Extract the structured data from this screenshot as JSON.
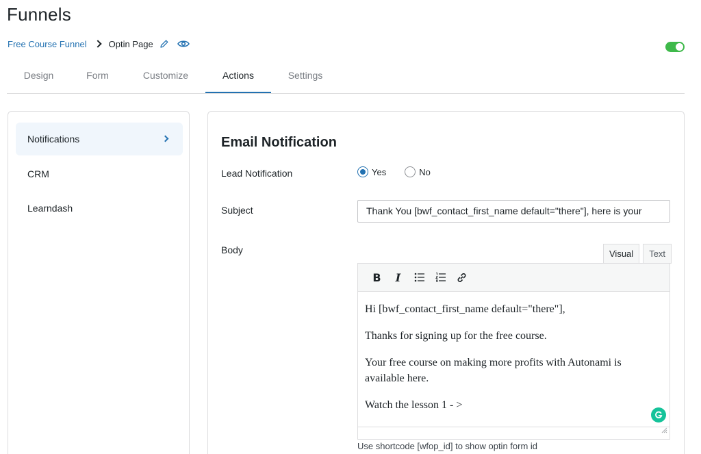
{
  "page": {
    "title": "Funnels"
  },
  "breadcrumb": {
    "parent": "Free Course Funnel",
    "current": "Optin Page"
  },
  "toggle": {
    "state": "on",
    "color": "#3eb94a"
  },
  "tabs": [
    {
      "label": "Design"
    },
    {
      "label": "Form"
    },
    {
      "label": "Customize"
    },
    {
      "label": "Actions",
      "active": true
    },
    {
      "label": "Settings"
    }
  ],
  "sidebar": {
    "items": [
      {
        "label": "Notifications",
        "active": true
      },
      {
        "label": "CRM"
      },
      {
        "label": "Learndash"
      }
    ]
  },
  "email": {
    "section_title": "Email Notification",
    "lead_label": "Lead Notification",
    "lead_options": [
      {
        "label": "Yes",
        "checked": true
      },
      {
        "label": "No",
        "checked": false
      }
    ],
    "subject_label": "Subject",
    "subject_value": "Thank You [bwf_contact_first_name default=\"there\"], here is your",
    "body_label": "Body",
    "editor_tabs": {
      "visual": "Visual",
      "text": "Text"
    },
    "toolbar": {
      "bold": "B",
      "italic": "I"
    },
    "body_paragraphs": [
      "Hi [bwf_contact_first_name default=\"there\"],",
      "Thanks for signing up for the free course.",
      "Your free course on making more profits with Autonami is available here.",
      "Watch the lesson 1 - >"
    ],
    "helper": "Use shortcode [wfop_id] to show optin form id"
  },
  "colors": {
    "accent": "#2271b1",
    "grammarly": "#15c39a"
  }
}
